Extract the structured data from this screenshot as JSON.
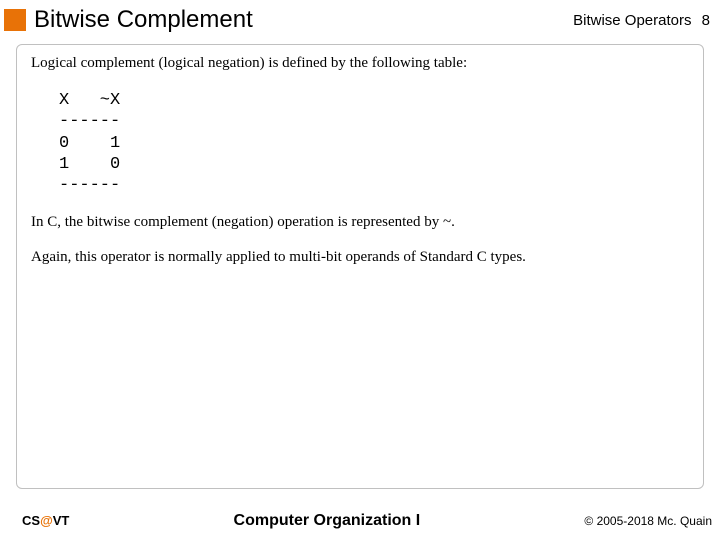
{
  "header": {
    "title": "Bitwise Complement",
    "section": "Bitwise Operators",
    "page_number": "8"
  },
  "body": {
    "intro": "Logical complement (logical negation) is defined by the following table:",
    "truth_table": "X   ~X\n------\n0    1\n1    0\n------",
    "para1": "In C, the bitwise complement (negation) operation is represented by ~.",
    "para2": "Again, this operator is normally applied to multi-bit operands of Standard C types."
  },
  "footer": {
    "left_prefix": "CS",
    "left_at": "@",
    "left_suffix": "VT",
    "center": "Computer Organization I",
    "right": "© 2005-2018 Mc. Quain"
  },
  "colors": {
    "accent": "#e87207"
  }
}
